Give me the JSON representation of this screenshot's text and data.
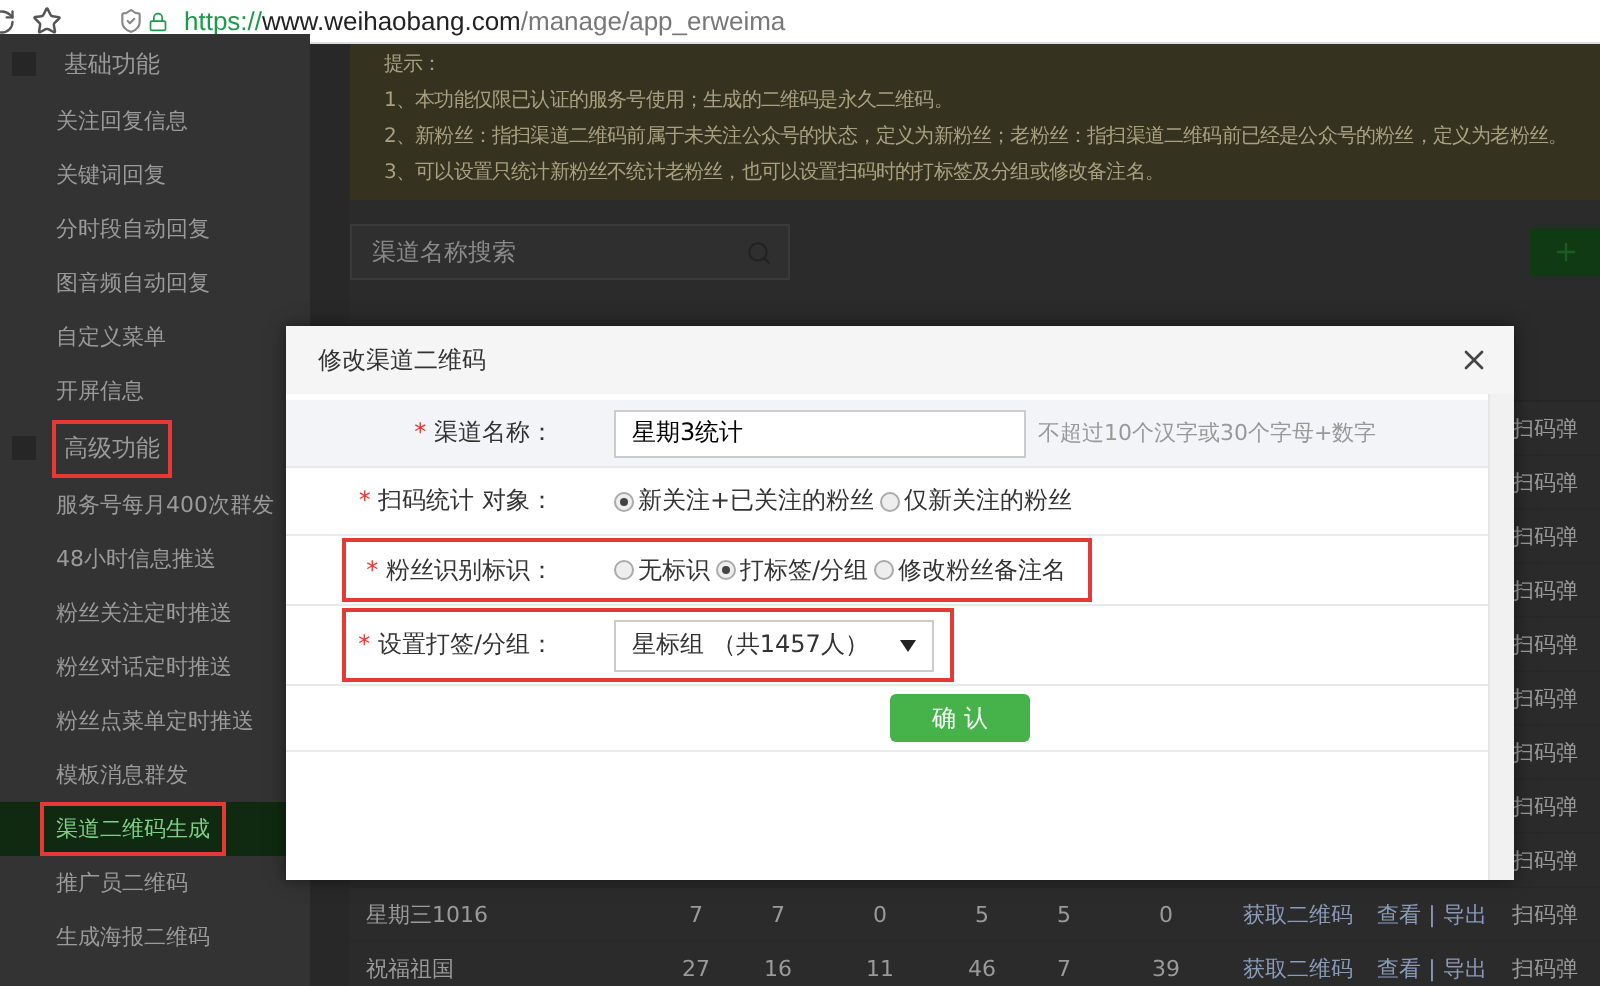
{
  "browser": {
    "url": {
      "scheme": "https://",
      "host": "www.weihaobang.com",
      "path": "/manage/app_erweima"
    }
  },
  "sidebar": {
    "sections": [
      {
        "title": "基础功能",
        "highlighted": false,
        "items": [
          {
            "label": "关注回复信息",
            "selected": false,
            "highlighted": false
          },
          {
            "label": "关键词回复",
            "selected": false,
            "highlighted": false
          },
          {
            "label": "分时段自动回复",
            "selected": false,
            "highlighted": false
          },
          {
            "label": "图音频自动回复",
            "selected": false,
            "highlighted": false
          },
          {
            "label": "自定义菜单",
            "selected": false,
            "highlighted": false
          },
          {
            "label": "开屏信息",
            "selected": false,
            "highlighted": false
          }
        ]
      },
      {
        "title": "高级功能",
        "highlighted": true,
        "items": [
          {
            "label": "服务号每月400次群发",
            "selected": false,
            "highlighted": false
          },
          {
            "label": "48小时信息推送",
            "selected": false,
            "highlighted": false
          },
          {
            "label": "粉丝关注定时推送",
            "selected": false,
            "highlighted": false
          },
          {
            "label": "粉丝对话定时推送",
            "selected": false,
            "highlighted": false
          },
          {
            "label": "粉丝点菜单定时推送",
            "selected": false,
            "highlighted": false
          },
          {
            "label": "模板消息群发",
            "selected": false,
            "highlighted": false
          },
          {
            "label": "渠道二维码生成",
            "selected": true,
            "highlighted": true
          },
          {
            "label": "推广员二维码",
            "selected": false,
            "highlighted": false
          },
          {
            "label": "生成海报二维码",
            "selected": false,
            "highlighted": false
          }
        ]
      }
    ]
  },
  "notice": {
    "title": "提示：",
    "lines": [
      "1、本功能仅限已认证的服务号使用；生成的二维码是永久二维码。",
      "2、新粉丝：指扫渠道二维码前属于未关注公众号的状态，定义为新粉丝；老粉丝：指扫渠道二维码前已经是公众号的粉丝，定义为老粉丝。",
      "3、可以设置只统计新粉丝不统计老粉丝，也可以设置扫码时的打标签及分组或修改备注名。"
    ]
  },
  "search": {
    "placeholder": "渠道名称搜索"
  },
  "table": {
    "rows": [
      {
        "kind": "covered",
        "last": "扫码弹"
      },
      {
        "kind": "covered",
        "last": "扫码弹"
      },
      {
        "kind": "covered",
        "last": "扫码弹"
      },
      {
        "kind": "covered",
        "last": "扫码弹"
      },
      {
        "kind": "covered",
        "last": "扫码弹"
      },
      {
        "kind": "covered",
        "last": "扫码弹"
      },
      {
        "kind": "covered",
        "last": "扫码弹"
      },
      {
        "kind": "covered",
        "last": "扫码弹"
      },
      {
        "kind": "covered",
        "last": "扫码弹"
      },
      {
        "kind": "full",
        "name": "星期三1016",
        "counts": [
          "7",
          "7",
          "0",
          "5",
          "5",
          "0"
        ],
        "qr_link": "获取二维码",
        "actions": "查看 | 导出",
        "last": "扫码弹"
      },
      {
        "kind": "full",
        "name": "祝福祖国",
        "counts": [
          "27",
          "16",
          "11",
          "46",
          "7",
          "39"
        ],
        "qr_link": "获取二维码",
        "actions": "查看 | 导出",
        "last": "扫码弹"
      }
    ]
  },
  "dialog": {
    "title": "修改渠道二维码",
    "fields": [
      {
        "kind": "text",
        "required_mark": "*",
        "label": "渠道名称：",
        "value": "星期3统计",
        "hint": "不超过10个汉字或30个字母+数字",
        "highlighted": false
      },
      {
        "kind": "radio",
        "required_mark": "*",
        "label": "扫码统计 对象：",
        "highlighted": false,
        "options": [
          {
            "label": "新关注+已关注的粉丝",
            "selected": true
          },
          {
            "label": "仅新关注的粉丝",
            "selected": false
          }
        ]
      },
      {
        "kind": "radio",
        "required_mark": "*",
        "label": "粉丝识别标识：",
        "highlighted": true,
        "options": [
          {
            "label": "无标识",
            "selected": false
          },
          {
            "label": "打标签/分组",
            "selected": true
          },
          {
            "label": "修改粉丝备注名",
            "selected": false
          }
        ]
      },
      {
        "kind": "select",
        "required_mark": "*",
        "label": "设置打签/分组：",
        "value": "星标组 （共1457人）",
        "highlighted": true
      }
    ],
    "confirm": "确 认"
  }
}
